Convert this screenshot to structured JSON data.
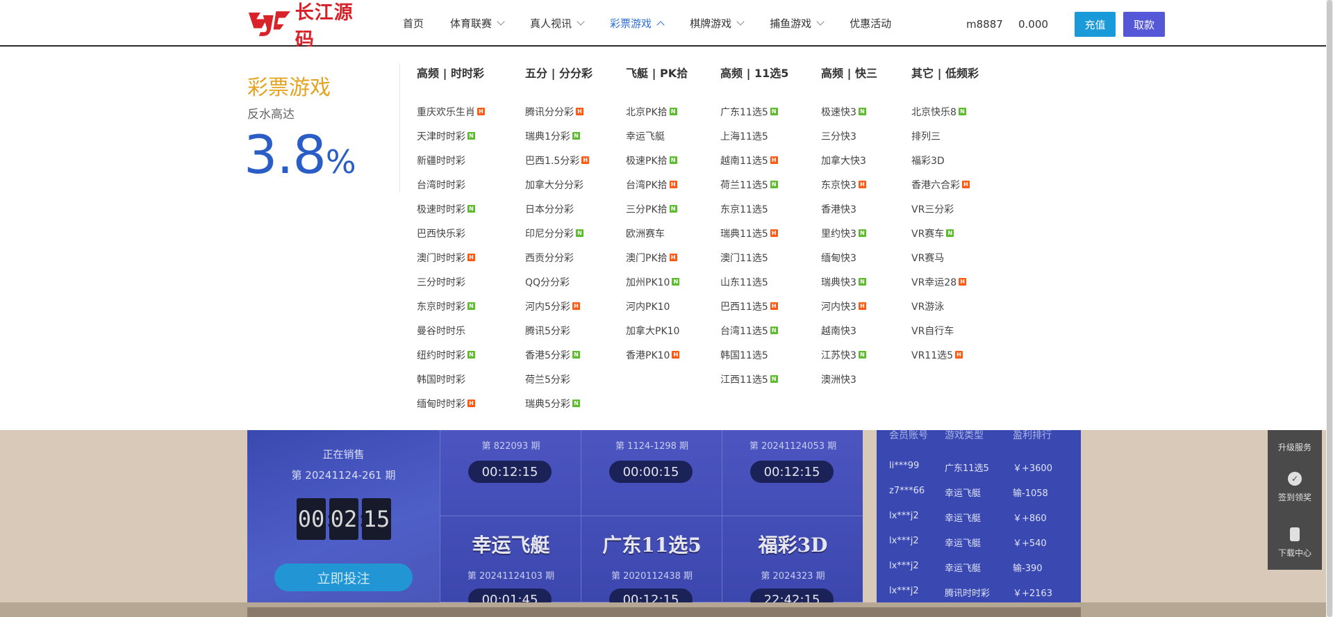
{
  "header": {
    "logo_text": "长江源码",
    "nav": [
      {
        "label": "首页",
        "dropdown": false,
        "active": false
      },
      {
        "label": "体育联赛",
        "dropdown": true,
        "active": false
      },
      {
        "label": "真人视讯",
        "dropdown": true,
        "active": false
      },
      {
        "label": "彩票游戏",
        "dropdown": true,
        "active": true
      },
      {
        "label": "棋牌游戏",
        "dropdown": true,
        "active": false
      },
      {
        "label": "捕鱼游戏",
        "dropdown": true,
        "active": false
      },
      {
        "label": "优惠活动",
        "dropdown": false,
        "active": false
      }
    ],
    "username": "m8887",
    "balance": "0.000",
    "recharge_label": "充值",
    "withdraw_label": "取款"
  },
  "dropdown": {
    "promo_title": "彩票游戏",
    "promo_sub": "反水高达",
    "promo_rate": "3.8",
    "promo_unit": "%",
    "columns": [
      {
        "title": "高频 | 时时彩",
        "games": [
          {
            "name": "重庆欢乐生肖",
            "badge": "hot"
          },
          {
            "name": "天津时时彩",
            "badge": "new"
          },
          {
            "name": "新疆时时彩",
            "badge": ""
          },
          {
            "name": "台湾时时彩",
            "badge": ""
          },
          {
            "name": "极速时时彩",
            "badge": "new"
          },
          {
            "name": "巴西快乐彩",
            "badge": ""
          },
          {
            "name": "澳门时时彩",
            "badge": "hot"
          },
          {
            "name": "三分时时彩",
            "badge": ""
          },
          {
            "name": "东京时时彩",
            "badge": "new"
          },
          {
            "name": "曼谷时时乐",
            "badge": ""
          },
          {
            "name": "纽约时时彩",
            "badge": "new"
          },
          {
            "name": "韩国时时彩",
            "badge": ""
          },
          {
            "name": "缅甸时时彩",
            "badge": "hot"
          }
        ]
      },
      {
        "title": "五分 | 分分彩",
        "games": [
          {
            "name": "腾讯分分彩",
            "badge": "hot"
          },
          {
            "name": "瑞典1分彩",
            "badge": "new"
          },
          {
            "name": "巴西1.5分彩",
            "badge": "hot"
          },
          {
            "name": "加拿大分分彩",
            "badge": ""
          },
          {
            "name": "日本分分彩",
            "badge": ""
          },
          {
            "name": "印尼分分彩",
            "badge": "new"
          },
          {
            "name": "西贡分分彩",
            "badge": ""
          },
          {
            "name": "QQ分分彩",
            "badge": ""
          },
          {
            "name": "河内5分彩",
            "badge": "hot"
          },
          {
            "name": "腾讯5分彩",
            "badge": ""
          },
          {
            "name": "香港5分彩",
            "badge": "new"
          },
          {
            "name": "荷兰5分彩",
            "badge": ""
          },
          {
            "name": "瑞典5分彩",
            "badge": "new"
          }
        ]
      },
      {
        "title": "飞艇 | PK拾",
        "games": [
          {
            "name": "北京PK拾",
            "badge": "new"
          },
          {
            "name": "幸运飞艇",
            "badge": ""
          },
          {
            "name": "极速PK拾",
            "badge": "new"
          },
          {
            "name": "台湾PK拾",
            "badge": "hot"
          },
          {
            "name": "三分PK拾",
            "badge": "new"
          },
          {
            "name": "欧洲赛车",
            "badge": ""
          },
          {
            "name": "澳门PK拾",
            "badge": "hot"
          },
          {
            "name": "加州PK10",
            "badge": "new"
          },
          {
            "name": "河内PK10",
            "badge": ""
          },
          {
            "name": "加拿大PK10",
            "badge": ""
          },
          {
            "name": "香港PK10",
            "badge": "hot"
          }
        ]
      },
      {
        "title": "高频 | 11选5",
        "games": [
          {
            "name": "广东11选5",
            "badge": "new"
          },
          {
            "name": "上海11选5",
            "badge": ""
          },
          {
            "name": "越南11选5",
            "badge": "hot"
          },
          {
            "name": "荷兰11选5",
            "badge": "new"
          },
          {
            "name": "东京11选5",
            "badge": ""
          },
          {
            "name": "瑞典11选5",
            "badge": "hot"
          },
          {
            "name": "澳门11选5",
            "badge": ""
          },
          {
            "name": "山东11选5",
            "badge": ""
          },
          {
            "name": "巴西11选5",
            "badge": "hot"
          },
          {
            "name": "台湾11选5",
            "badge": "new"
          },
          {
            "name": "韩国11选5",
            "badge": ""
          },
          {
            "name": "江西11选5",
            "badge": "new"
          }
        ]
      },
      {
        "title": "高频 | 快三",
        "games": [
          {
            "name": "极速快3",
            "badge": "new"
          },
          {
            "name": "三分快3",
            "badge": ""
          },
          {
            "name": "加拿大快3",
            "badge": ""
          },
          {
            "name": "东京快3",
            "badge": "hot"
          },
          {
            "name": "香港快3",
            "badge": ""
          },
          {
            "name": "里约快3",
            "badge": "new"
          },
          {
            "name": "缅甸快3",
            "badge": ""
          },
          {
            "name": "瑞典快3",
            "badge": "new"
          },
          {
            "name": "河内快3",
            "badge": "hot"
          },
          {
            "name": "越南快3",
            "badge": ""
          },
          {
            "name": "江苏快3",
            "badge": "new"
          },
          {
            "name": "澳洲快3",
            "badge": ""
          }
        ]
      },
      {
        "title": "其它 | 低频彩",
        "games": [
          {
            "name": "北京快乐8",
            "badge": "new"
          },
          {
            "name": "排列三",
            "badge": ""
          },
          {
            "name": "福彩3D",
            "badge": ""
          },
          {
            "name": "香港六合彩",
            "badge": "hot"
          },
          {
            "name": "VR三分彩",
            "badge": ""
          },
          {
            "name": "VR赛车",
            "badge": "new"
          },
          {
            "name": "VR赛马",
            "badge": ""
          },
          {
            "name": "VR幸运28",
            "badge": "hot"
          },
          {
            "name": "VR游泳",
            "badge": ""
          },
          {
            "name": "VR自行车",
            "badge": ""
          },
          {
            "name": "VR11选5",
            "badge": "hot"
          }
        ]
      }
    ]
  },
  "sale": {
    "status": "正在销售",
    "issue": "第 20241124-261 期",
    "timer": [
      "00",
      "02",
      "15"
    ],
    "bet_label": "立即投注"
  },
  "grid": [
    {
      "name": "",
      "issue": "第 822093 期",
      "time": "00:12:15"
    },
    {
      "name": "",
      "issue": "第 1124-1298 期",
      "time": "00:00:15"
    },
    {
      "name": "",
      "issue": "第 20241124053 期",
      "time": "00:12:15"
    },
    {
      "name": "幸运飞艇",
      "issue": "第 20241124103 期",
      "time": "00:01:45"
    },
    {
      "name": "广东11选5",
      "issue": "第 2020112438 期",
      "time": "00:12:15"
    },
    {
      "name": "福彩3D",
      "issue": "第 2024323 期",
      "time": "22:42:15"
    }
  ],
  "ranking": {
    "headers": [
      "会员账号",
      "游戏类型",
      "盈利排行"
    ],
    "rows": [
      [
        "li***99",
        "广东11选5",
        "￥+3600"
      ],
      [
        "z7***66",
        "幸运飞艇",
        "输-1058"
      ],
      [
        "lx***j2",
        "幸运飞艇",
        "￥+860"
      ],
      [
        "lx***j2",
        "幸运飞艇",
        "￥+540"
      ],
      [
        "lx***j2",
        "幸运飞艇",
        "输-390"
      ],
      [
        "lx***j2",
        "腾讯时时彩",
        "￥+2163"
      ]
    ]
  },
  "side_menu": {
    "upgrade": "升级服务",
    "checkin": "签到领奖",
    "download": "下载中心"
  },
  "colors": {
    "accent_blue": "#2b6fd6",
    "promo_gold": "#e4a422",
    "hot_badge": "#ff5a14",
    "new_badge": "#5dbb2e",
    "recharge": "#1a9ad8",
    "withdraw": "#5457d6"
  }
}
